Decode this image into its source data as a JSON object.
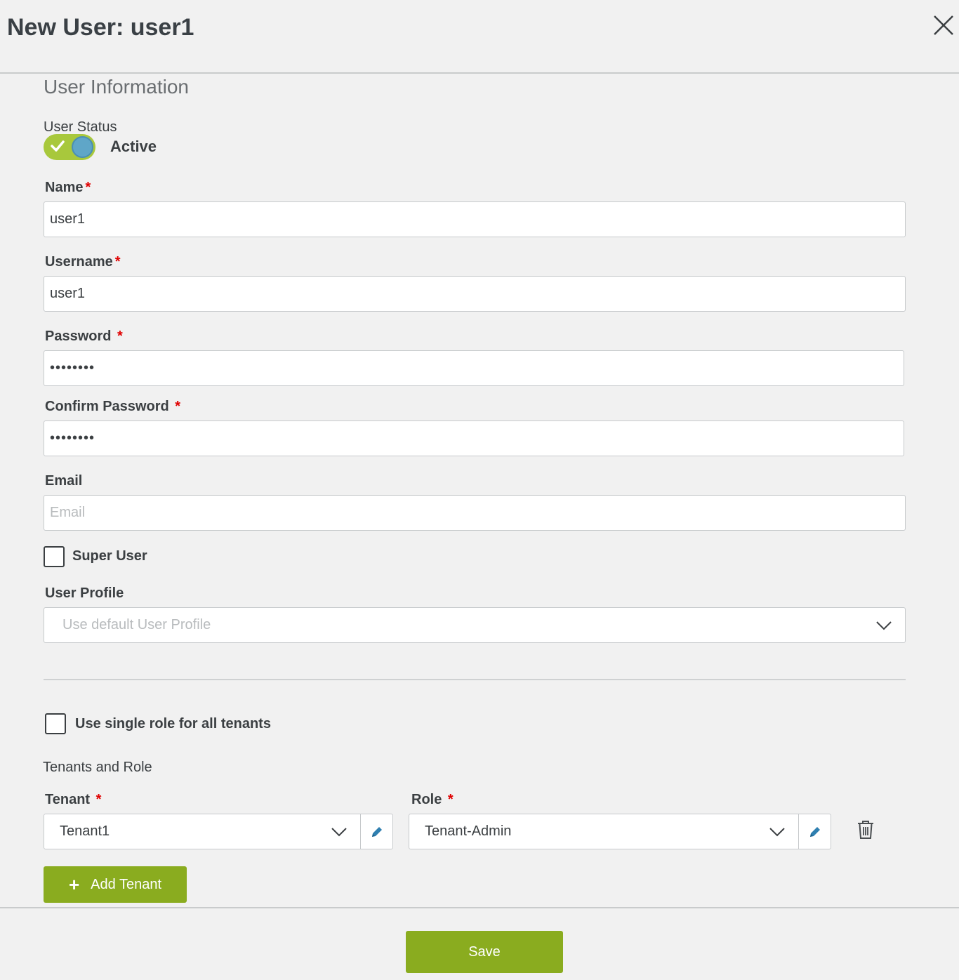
{
  "dialog": {
    "title": "New User: user1"
  },
  "section": {
    "title": "User Information"
  },
  "user_status": {
    "label": "User Status",
    "value": "Active",
    "enabled": true
  },
  "fields": {
    "name": {
      "label": "Name",
      "value": "user1",
      "required": "*"
    },
    "username": {
      "label": "Username",
      "value": "user1",
      "required": "*"
    },
    "password": {
      "label": "Password",
      "value": "••••••••",
      "required": "*"
    },
    "confirm_password": {
      "label": "Confirm Password",
      "value": "••••••••",
      "required": "*"
    },
    "email": {
      "label": "Email",
      "value": "",
      "placeholder": "Email"
    }
  },
  "super_user": {
    "label": "Super User",
    "checked": false
  },
  "user_profile": {
    "label": "User Profile",
    "placeholder": "Use default User Profile"
  },
  "single_role": {
    "label": "Use single role for all tenants",
    "checked": false
  },
  "tenants_and_role": {
    "title": "Tenants and Role",
    "tenant_label": "Tenant",
    "role_label": "Role",
    "required": "*",
    "rows": [
      {
        "tenant": "Tenant1",
        "role": "Tenant-Admin"
      }
    ],
    "add_label": "Add Tenant"
  },
  "footer": {
    "save_label": "Save"
  },
  "colors": {
    "accent": "#8aac1f",
    "toggle_on": "#a8c83c",
    "knob": "#5fa6c8",
    "required": "#e00000",
    "edit_icon": "#2f7fb0"
  }
}
